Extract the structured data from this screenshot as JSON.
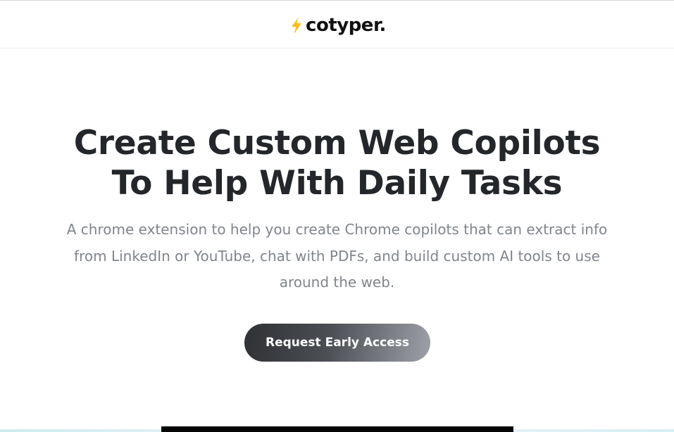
{
  "header": {
    "logo_icon": "lightning-bolt-icon",
    "logo_icon_color": "#F5B800",
    "logo_text": "cotyper."
  },
  "hero": {
    "headline_line1": "Create Custom Web Copilots",
    "headline_line2": "To Help With Daily Tasks",
    "subtitle": "A chrome extension to help you create Chrome copilots that can extract info from LinkedIn or YouTube, chat with PDFs, and build custom AI tools to use around the web.",
    "cta_label": "Request Early Access"
  },
  "colors": {
    "headline": "#23262B",
    "subtitle": "#80858C",
    "cta_gradient_start": "#2F3134",
    "cta_gradient_end": "#9EA2A8"
  }
}
